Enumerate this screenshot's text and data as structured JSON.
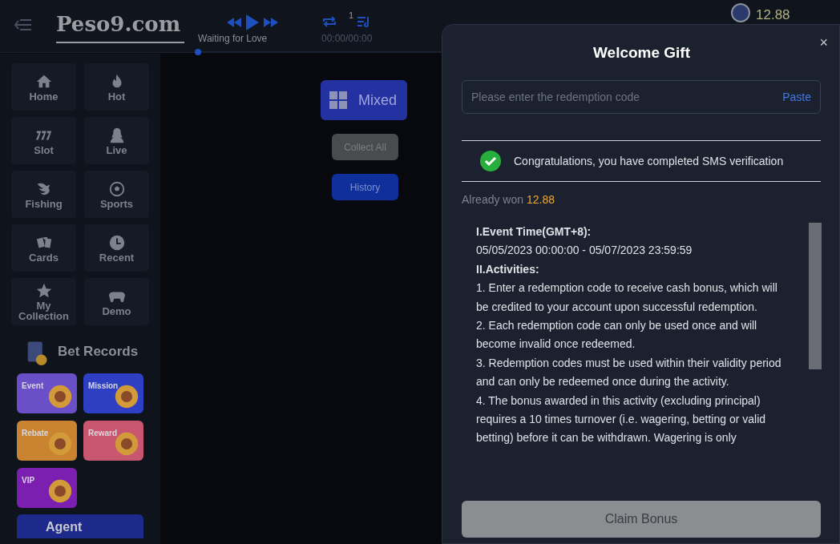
{
  "header": {
    "logo": "Peso9.com",
    "track": "Waiting for Love",
    "queue_count": "1",
    "time": "00:00/00:00",
    "balance": "12.88",
    "progress": {
      "level": 0.0
    }
  },
  "sidebar": {
    "items": [
      {
        "label": "Home"
      },
      {
        "label": "Hot"
      },
      {
        "label": "Slot"
      },
      {
        "label": "Live"
      },
      {
        "label": "Fishing"
      },
      {
        "label": "Sports"
      },
      {
        "label": "Cards"
      },
      {
        "label": "Recent"
      },
      {
        "label": "My Collection"
      },
      {
        "label": "Demo"
      }
    ],
    "bet_records": "Bet Records",
    "promos": [
      {
        "label": "Event",
        "color": "#6a4fc9"
      },
      {
        "label": "Mission",
        "color": "#2f3fc4"
      },
      {
        "label": "Rebate",
        "color": "#c98331"
      },
      {
        "label": "Reward",
        "color": "#c9566f"
      },
      {
        "label": "VIP",
        "color": "#7a1fb0"
      }
    ],
    "agent": "Agent"
  },
  "main": {
    "category": "Mixed",
    "collect_all": {
      "label": "Collect All",
      "disabled": true
    },
    "history": "History"
  },
  "modal": {
    "title": "Welcome Gift",
    "close": "×",
    "code_field": {
      "placeholder": "Please enter the redemption code"
    },
    "paste": "Paste",
    "status": {
      "text": "Congratulations, you have completed SMS verification",
      "verified": true
    },
    "already_won_label": "Already won",
    "already_won_value": "12.88",
    "rules": [
      {
        "kind": "heading",
        "text": "I.Event Time(GMT+8):"
      },
      {
        "kind": "text",
        "text": "05/05/2023 00:00:00 - 05/07/2023 23:59:59"
      },
      {
        "kind": "heading",
        "text": "II.Activities:"
      },
      {
        "kind": "text",
        "text": "1. Enter a redemption code to receive cash bonus, which will be credited to your account upon successful redemption."
      },
      {
        "kind": "text",
        "text": "2. Each redemption code can only be used once and will become invalid once redeemed."
      },
      {
        "kind": "text",
        "text": "3. Redemption codes must be used within their validity period and can only be redeemed once during the activity."
      },
      {
        "kind": "text",
        "text": "4. The bonus awarded in this activity (excluding principal) requires a 10 times turnover (i.e. wagering, betting or valid betting) before it can be withdrawn. Wagering is only"
      }
    ],
    "claim": {
      "label": "Claim Bonus",
      "disabled": true
    }
  }
}
